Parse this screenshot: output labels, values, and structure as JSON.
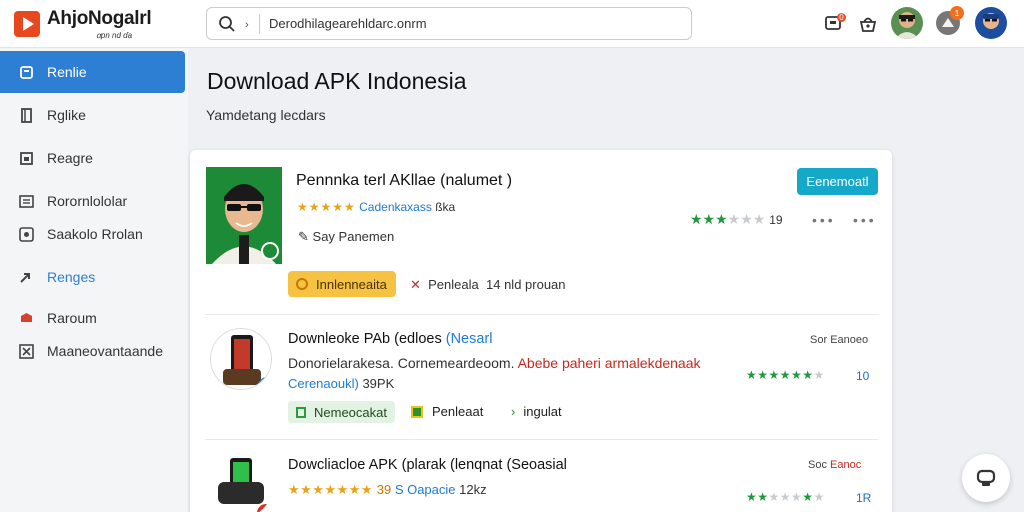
{
  "header": {
    "brand": "AhjoNogalrl",
    "brand_sub": "ꭤpn nd ɗa",
    "search_value": "Derodhilagearehldarc.onrm",
    "notification_count": "0",
    "alert_count": "1"
  },
  "sidebar": {
    "items": [
      {
        "label": "Renlie",
        "icon": "home-icon",
        "state": "active"
      },
      {
        "label": "Rglike",
        "icon": "page-icon"
      },
      {
        "label": "Reagre",
        "icon": "image-icon"
      },
      {
        "label": "Rorornlololar",
        "icon": "list-icon"
      },
      {
        "label": "Saakolo Rrolan",
        "icon": "card-icon"
      },
      {
        "label": "Renges",
        "icon": "arrow-icon",
        "state": "highlight"
      },
      {
        "label": "Raroum",
        "icon": "shield-icon"
      },
      {
        "label": "Maaneovantaande",
        "icon": "close-box-icon"
      }
    ]
  },
  "main": {
    "title": "Download APK Indonesia",
    "subtitle": "Yamdetang lecdars"
  },
  "featured": {
    "title": "Pennnka terl AKllae",
    "title_suffix": "(nalumet )",
    "stars": "★★★★★",
    "tag": "Ϲadenkaxass",
    "tag_suffix": "ßka",
    "developer": "Say Panemen",
    "button": "Eenemoatl",
    "rating_count": "19",
    "chip": "Innlenneaita",
    "location": "Penleala",
    "location_count": "14",
    "location_suffix": "nld prouan"
  },
  "rows": [
    {
      "title": "Downleoke PAb",
      "title_mid": "(edloes",
      "title_tag": "(Nesarl",
      "desc": "Donorielarakesa.",
      "desc_mid": "Cornemeardeoom.",
      "desc_red": "Abebe paheri armalekdenaak",
      "size_tag": "Cerenaoukl)",
      "size": "39PK",
      "right_prefix": "Sor",
      "right_value": "Eanoeo",
      "rating_count": "10",
      "chip1": "Nemeocakat",
      "chip2": "Penleaat",
      "chip3": "ingulat"
    },
    {
      "title": "Dowcliacloe APK",
      "title_mid": "(plarak",
      "title_mid2": "(lenqnat",
      "title_tag": "(Seoasial",
      "stars": "★★★★★★★",
      "stars_num": "39",
      "size_tag": "S Oapacie",
      "size": "12kz",
      "right_prefix": "Soc",
      "right_value": "Eanoc",
      "rating_count": "1R"
    }
  ],
  "colors": {
    "accent": "#2d7fd3",
    "button": "#16a8c9",
    "star_green": "#1e9a3d",
    "star_orange": "#e9a316",
    "chip_orange": "#f6c242",
    "chip_green": "#e3f3e3",
    "error_red": "#c9281c"
  }
}
